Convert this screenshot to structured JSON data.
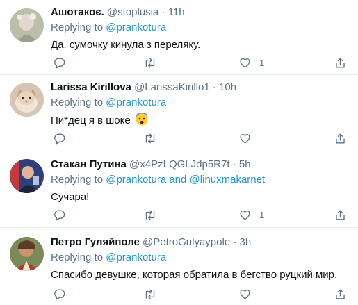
{
  "tweets": [
    {
      "name": "Ашотакоє.",
      "handle": "@stoplusia",
      "sep": "·",
      "time": "11h",
      "replying_label": "Replying to",
      "mentions": [
        "@prankotura"
      ],
      "text": "Да. сумочку кинула з переляку.",
      "like_count": "1"
    },
    {
      "name": "Larissa Kirillova",
      "handle": "@LarissaKirillo1",
      "sep": "·",
      "time": "10h",
      "replying_label": "Replying to",
      "mentions": [
        "@prankotura"
      ],
      "text": "Пи*дец я в шоке",
      "text_emoji": "fearful-face-icon",
      "like_count": ""
    },
    {
      "name": "Стакан Путина",
      "handle": "@x4PzLQGLJdp5R7t",
      "sep": "·",
      "time": "5h",
      "replying_label": "Replying to",
      "mentions": [
        "@prankotura",
        "@linuxmakarnet"
      ],
      "mention_joiner": "and",
      "text": "Сучара!",
      "like_count": "1"
    },
    {
      "name": "Петро Гуляйполе",
      "handle": "@PetroGulyaypole",
      "sep": "·",
      "time": "3h",
      "replying_label": "Replying to",
      "mentions": [
        "@prankotura"
      ],
      "text": "Спасибо девушке, которая обратила в бегство руцкий мир.",
      "like_count": ""
    }
  ],
  "icons": {
    "reply": "reply-icon",
    "retweet": "retweet-icon",
    "like": "heart-icon",
    "share": "share-icon"
  },
  "colors": {
    "mention": "#1b95e0",
    "secondary_text": "#5b7083",
    "divider": "#e6ecf0"
  }
}
